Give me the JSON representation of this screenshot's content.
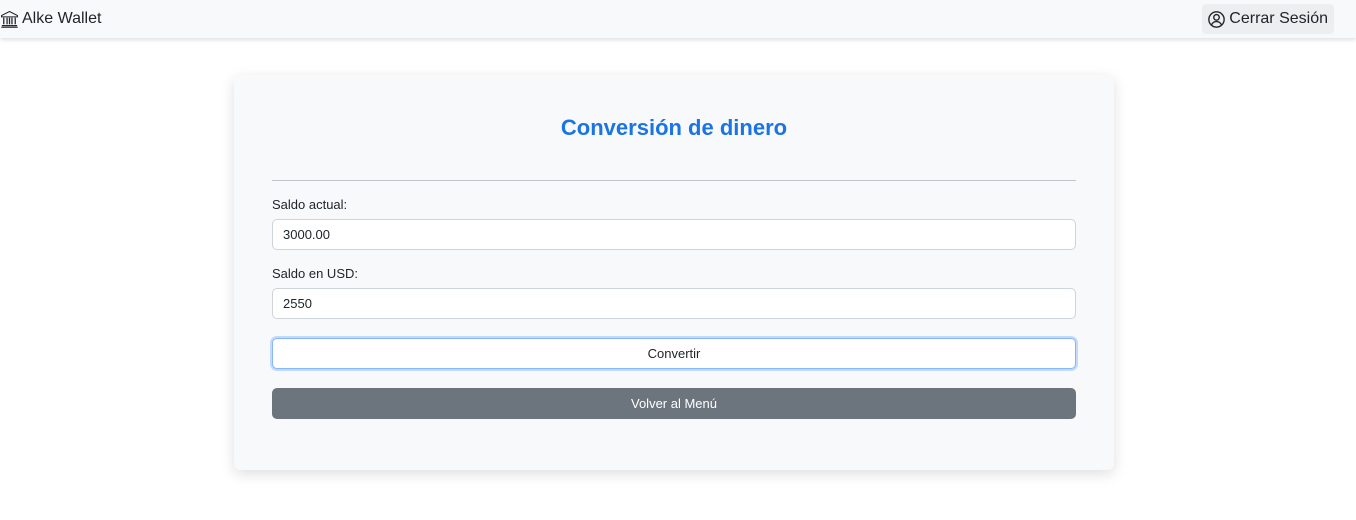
{
  "navbar": {
    "brand_label": "Alke Wallet",
    "brand_icon": "bank-icon",
    "logout_label": "Cerrar Sesión",
    "logout_icon": "person-circle-icon"
  },
  "form": {
    "title": "Conversión de dinero",
    "balance_label": "Saldo actual:",
    "balance_value": "3000.00",
    "usd_label": "Saldo en USD:",
    "usd_value": "2550",
    "convert_button": "Convertir",
    "back_button": "Volver al Menú"
  },
  "colors": {
    "title": "#1b74e4",
    "back_button_bg": "#6c757d",
    "navbar_bg": "#f8f9fa",
    "card_bg": "#f8f9fa"
  }
}
